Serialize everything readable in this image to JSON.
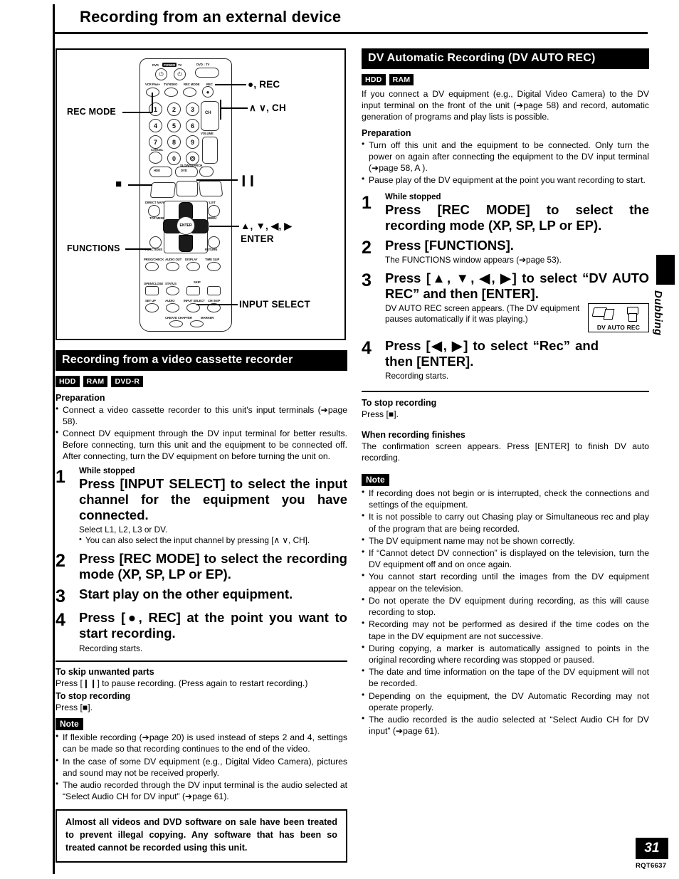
{
  "page": {
    "title": "Recording from an external device",
    "number": "31",
    "doc_code": "RQT6637",
    "side_tab_label": "Dubbing"
  },
  "remote_figure": {
    "callouts": [
      {
        "label": "REC MODE"
      },
      {
        "label": "●, REC"
      },
      {
        "label": "∧  ∨, CH"
      },
      {
        "label": "■"
      },
      {
        "label": "❙❙"
      },
      {
        "label": "▲, ▼, ◀, ▶"
      },
      {
        "label": "ENTER"
      },
      {
        "label": "FUNCTIONS"
      },
      {
        "label": "INPUT SELECT"
      }
    ],
    "remote_text": {
      "dvd_power": "DVD",
      "power_chip": "POWER",
      "tv_power": "TV",
      "dvd_tv_switch": "DVD  ↕  TV",
      "row1": [
        "VCR Plus+",
        "TV/VIDEO",
        "REC MODE",
        "REC"
      ],
      "cancel": "CANCEL",
      "hdd": "HDD",
      "dvd": "DVD",
      "ch": "CH",
      "volume": "VOLUME",
      "slow_search": "SLOW/SEARCH",
      "direct_navigator": "DIRECT NAVIGATOR",
      "top_menu": "TOP MENU",
      "play_list": "PLAY LIST",
      "menu": "MENU",
      "enter": "ENTER",
      "functions": "FUNCTIONS",
      "return": "RETURN",
      "row_func": [
        "PROG/CHECK",
        "AUDIO OUT",
        "DISPLAY",
        "TIME SLIP"
      ],
      "row_open": [
        "OPEN/CLOSE",
        "STATUS",
        "SKIP"
      ],
      "row_setup": [
        "SET UP",
        "AUDIO",
        "INPUT SELECT",
        "CM SKIP"
      ],
      "row_bottom": [
        "CREATE CHAPTER",
        "MARKER"
      ]
    }
  },
  "left_column": {
    "section_header": "Recording from a video cassette recorder",
    "media_chips": [
      "HDD",
      "RAM",
      "DVD-R"
    ],
    "preparation_heading": "Preparation",
    "preparation_bullets": [
      "Connect a video cassette recorder to this unit's input terminals (➔page 58).",
      "Connect DV equipment through the DV input terminal for better results. Before connecting, turn this unit and the equipment to be connected off. After connecting, turn the DV equipment on before turning the unit on."
    ],
    "steps": [
      {
        "num": "1",
        "pre": "While stopped",
        "main": "Press [INPUT SELECT] to select the input channel for the equipment you have connected.",
        "sub": "Select L1, L2, L3 or DV.",
        "sub_bullets": [
          "You can also select the input channel by pressing [∧  ∨, CH]."
        ]
      },
      {
        "num": "2",
        "pre": "",
        "main": "Press [REC MODE] to select the recording mode (XP, SP, LP or EP).",
        "sub": "",
        "sub_bullets": []
      },
      {
        "num": "3",
        "pre": "",
        "main": "Start play on the other equipment.",
        "sub": "",
        "sub_bullets": []
      },
      {
        "num": "4",
        "pre": "",
        "main": "Press [●, REC] at the point you want to start recording.",
        "sub": "Recording starts.",
        "sub_bullets": []
      }
    ],
    "skip_heading": "To skip unwanted parts",
    "skip_text": "Press [❙❙] to pause recording. (Press again to restart recording.)",
    "stop_heading": "To stop recording",
    "stop_text": "Press [■].",
    "note_label": "Note",
    "note_bullets": [
      "If flexible recording (➔page 20) is used instead of steps 2 and 4, settings can be made so that recording continues to the end of the video.",
      "In the case of some DV equipment (e.g., Digital Video Camera), pictures and sound may not be received properly.",
      "The audio recorded through the DV input terminal is the audio selected at “Select Audio CH for DV input” (➔page 61)."
    ],
    "warning_text": "Almost all videos and DVD software on sale have been treated to prevent illegal copying. Any software that has been so treated cannot be recorded using this unit."
  },
  "right_column": {
    "section_header": "DV Automatic Recording (DV AUTO REC)",
    "media_chips": [
      "HDD",
      "RAM"
    ],
    "intro": "If you connect a DV equipment (e.g., Digital Video Camera) to the DV input terminal on the front of the unit (➔page 58) and record, automatic generation of programs and play lists is possible.",
    "preparation_heading": "Preparation",
    "preparation_bullets": [
      "Turn off this unit and the equipment to be connected. Only turn the power on again after connecting the equipment to the DV input terminal (➔page 58, A ).",
      "Pause play of the DV equipment at the point you want recording to start."
    ],
    "steps": [
      {
        "num": "1",
        "pre": "While stopped",
        "main": "Press [REC MODE] to select the recording mode (XP, SP, LP or EP).",
        "sub": "",
        "sub_bullets": []
      },
      {
        "num": "2",
        "pre": "",
        "main": "Press [FUNCTIONS].",
        "sub": "The FUNCTIONS window appears (➔page 53).",
        "sub_bullets": []
      },
      {
        "num": "3",
        "pre": "",
        "main": "Press [▲, ▼, ◀, ▶] to select “DV AUTO REC” and then [ENTER].",
        "sub": "DV AUTO REC screen appears. (The DV equipment pauses automatically if it was playing.)",
        "sub_bullets": []
      },
      {
        "num": "4",
        "pre": "",
        "main": "Press [◀, ▶] to select “Rec” and then [ENTER].",
        "sub": "Recording starts.",
        "sub_bullets": []
      }
    ],
    "dv_figure_caption": "DV AUTO REC",
    "stop_heading": "To stop recording",
    "stop_text": "Press [■].",
    "finish_heading": "When recording finishes",
    "finish_text": "The confirmation screen appears. Press [ENTER] to finish DV auto recording.",
    "note_label": "Note",
    "note_bullets": [
      "If recording does not begin or is interrupted, check the connections and settings of the equipment.",
      "It is not possible to carry out Chasing play or Simultaneous rec and play of the program that are being recorded.",
      "The DV equipment name may not be shown correctly.",
      "If “Cannot detect DV connection” is displayed on the television, turn the DV equipment off and on once again.",
      "You cannot start recording until the images from the DV equipment appear on the television.",
      "Do not operate the DV equipment during recording, as this will cause recording to stop.",
      "Recording may not be performed as desired if the time codes on the tape in the DV equipment are not successive.",
      "During copying, a marker is automatically assigned to points in the original recording where recording was stopped or paused.",
      "The date and time information on the tape of the DV equipment will not be recorded.",
      "Depending on the equipment, the DV Automatic Recording may not operate properly.",
      "The audio recorded is the audio selected at “Select Audio CH for DV input” (➔page 61)."
    ]
  }
}
